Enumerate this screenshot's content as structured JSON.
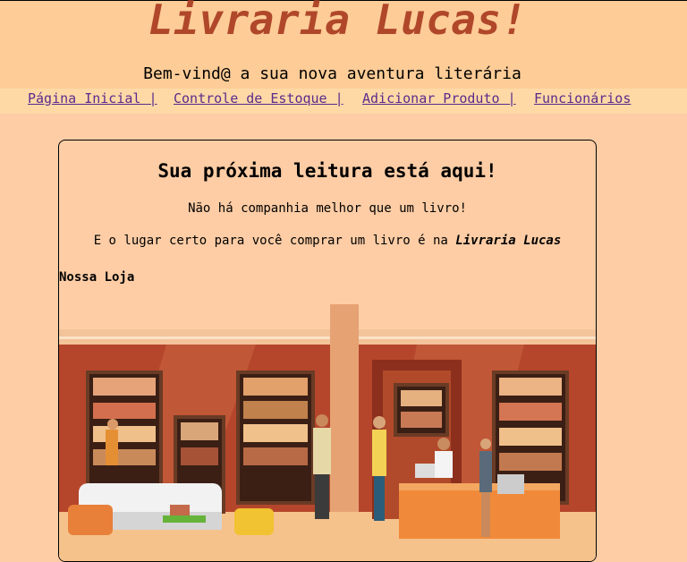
{
  "header": {
    "title": "Livraria Lucas!",
    "tagline": "Bem-vind@ a sua nova aventura literária"
  },
  "nav": {
    "items": [
      {
        "label": "Página Inicial |"
      },
      {
        "label": "Controle de Estoque |"
      },
      {
        "label": "Adicionar Produto |"
      },
      {
        "label": "Funcionários"
      }
    ]
  },
  "main": {
    "title": "Sua próxima leitura está aqui!",
    "line1": "Não há companhia melhor que um livro!",
    "line2_prefix": "E o lugar certo para você comprar um livro é na ",
    "line2_brand": "Livraria Lucas",
    "store_heading": "Nossa Loja"
  },
  "colors": {
    "background": "#fecda5",
    "header_background": "#fdcc97",
    "nav_background": "#fed9a6",
    "title": "#b0472a",
    "link": "#5b2b8c"
  }
}
